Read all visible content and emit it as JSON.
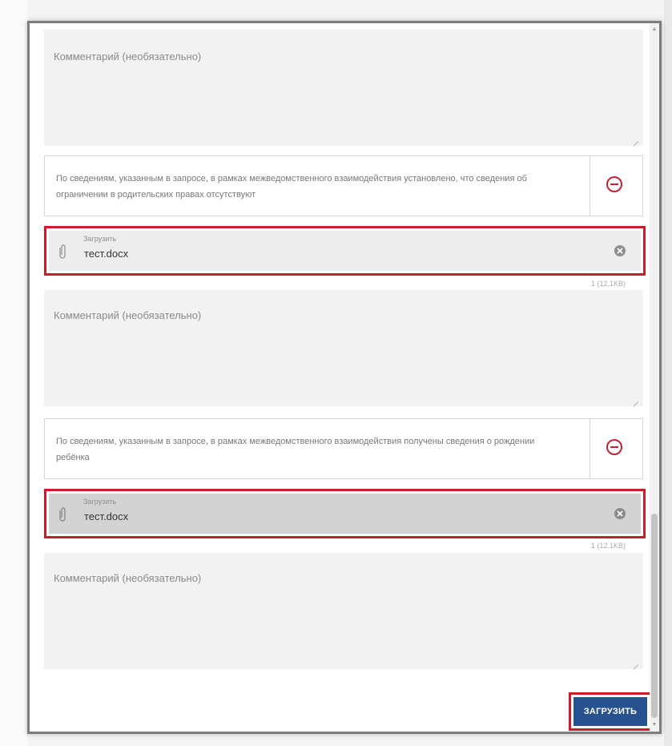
{
  "comment_placeholder": "Комментарий (необязательно)",
  "documents": [
    {
      "text": "По сведениям, указанным в запросе, в рамках межведомственного взаимодействия установлено, что сведения об ограничении в родительских правах отсутствуют",
      "upload_label": "Загрузить",
      "file_name": "тест.docx",
      "file_size": "1 (12.1KB)"
    },
    {
      "text": "По сведениям, указанным в запросе, в рамках межведомственного взаимодействия получены сведения о рождении ребёнка",
      "upload_label": "Загрузить",
      "file_name": "тест.docx",
      "file_size": "1 (12.1KB)"
    }
  ],
  "submit_label": "ЗАГРУЗИТЬ",
  "colors": {
    "accent_button": "#27528f",
    "highlight_border": "#cc1c2a",
    "remove_icon": "#c8202f"
  }
}
